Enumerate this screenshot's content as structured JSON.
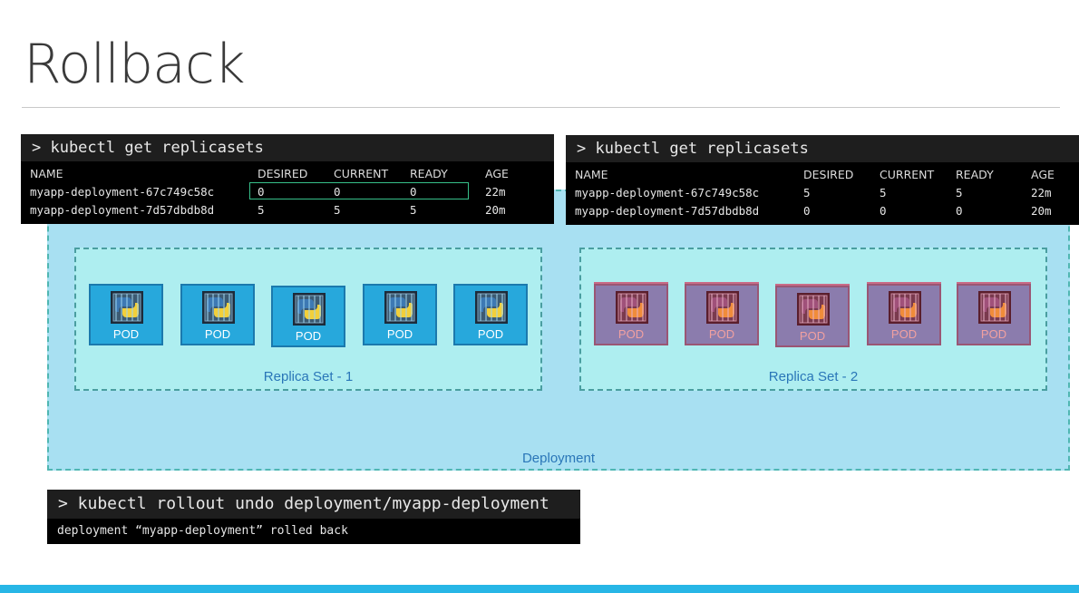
{
  "slide": {
    "title": "Rollback"
  },
  "terminal_left": {
    "command": "> kubectl get replicasets",
    "headers": [
      "NAME",
      "DESIRED",
      "CURRENT",
      "READY",
      "AGE"
    ],
    "rows": [
      [
        "myapp-deployment-67c749c58c",
        "0",
        "0",
        "0",
        "22m"
      ],
      [
        "myapp-deployment-7d57dbdb8d",
        "5",
        "5",
        "5",
        "20m"
      ]
    ]
  },
  "terminal_right": {
    "command": "> kubectl get replicasets",
    "headers": [
      "NAME",
      "DESIRED",
      "CURRENT",
      "READY",
      "AGE"
    ],
    "rows": [
      [
        "myapp-deployment-67c749c58c",
        "5",
        "5",
        "5",
        "22m"
      ],
      [
        "myapp-deployment-7d57dbdb8d",
        "0",
        "0",
        "0",
        "20m"
      ]
    ]
  },
  "diagram": {
    "deployment_label": "Deployment",
    "replicaset_1": {
      "label": "Replica Set - 1",
      "pods": [
        "POD",
        "POD",
        "POD",
        "POD",
        "POD"
      ]
    },
    "replicaset_2": {
      "label": "Replica Set - 2",
      "pods": [
        "POD",
        "POD",
        "POD",
        "POD",
        "POD"
      ]
    }
  },
  "terminal_bottom": {
    "command": "> kubectl rollout undo deployment/myapp-deployment",
    "output": "deployment “myapp-deployment” rolled back"
  },
  "colors": {
    "deployment_bg": "#a8e0f2",
    "replicaset_bg": "#aeeef0",
    "pod_blue": "#27a8dc",
    "pod_red": "#8b7cad",
    "accent_bar": "#27b6e6",
    "highlight_border": "#37c08a"
  },
  "icons": {
    "pod_icon": "python-container-icon"
  }
}
